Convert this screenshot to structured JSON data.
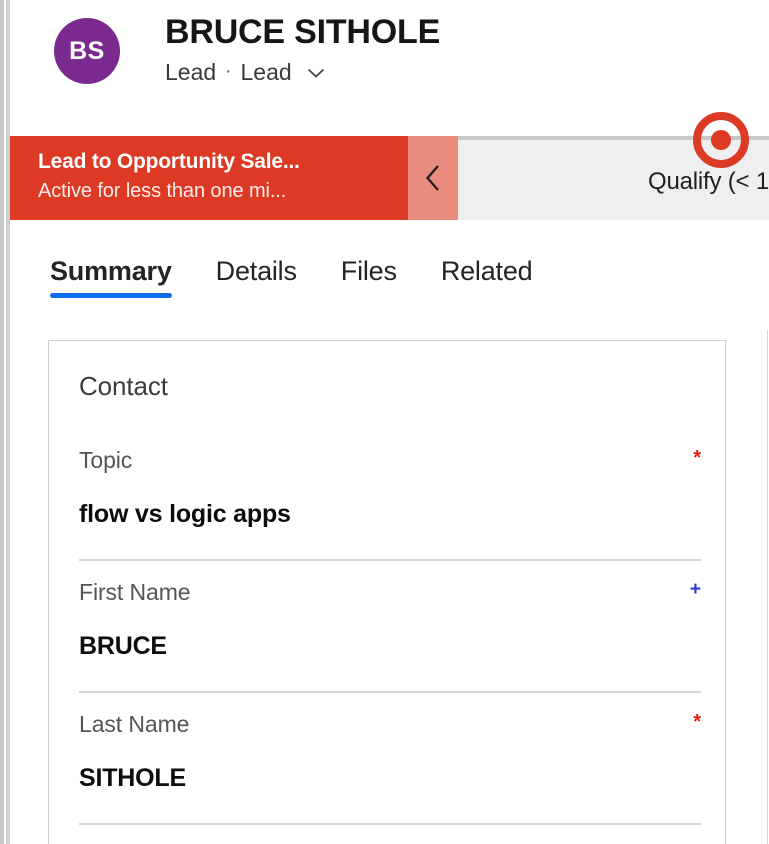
{
  "header": {
    "avatar_initials": "BS",
    "record_name": "BRUCE SITHOLE",
    "entity_label": "Lead",
    "separator": "·",
    "form_label": "Lead",
    "dropdown_icon": "chevron-down-icon",
    "avatar_color": "#7a2a8f"
  },
  "process_flow": {
    "name": "Lead to Opportunity Sale...",
    "status": "Active for less than one mi...",
    "collapse_icon": "chevron-left-icon",
    "stage_icon": "target-icon",
    "stage_label": "Qualify  (< 1",
    "active_color": "#dc3a24",
    "collapse_color": "#e98b7f",
    "stage_background": "#efefef"
  },
  "tabs": [
    {
      "label": "Summary",
      "active": true
    },
    {
      "label": "Details",
      "active": false
    },
    {
      "label": "Files",
      "active": false
    },
    {
      "label": "Related",
      "active": false
    }
  ],
  "tab_accent_color": "#0f6cec",
  "form": {
    "section_title": "Contact",
    "fields": [
      {
        "label": "Topic",
        "value": "flow vs logic apps",
        "marker": "*",
        "marker_type": "required"
      },
      {
        "label": "First Name",
        "value": "BRUCE",
        "marker": "+",
        "marker_type": "recommended"
      },
      {
        "label": "Last Name",
        "value": "SITHOLE",
        "marker": "*",
        "marker_type": "required"
      }
    ]
  }
}
